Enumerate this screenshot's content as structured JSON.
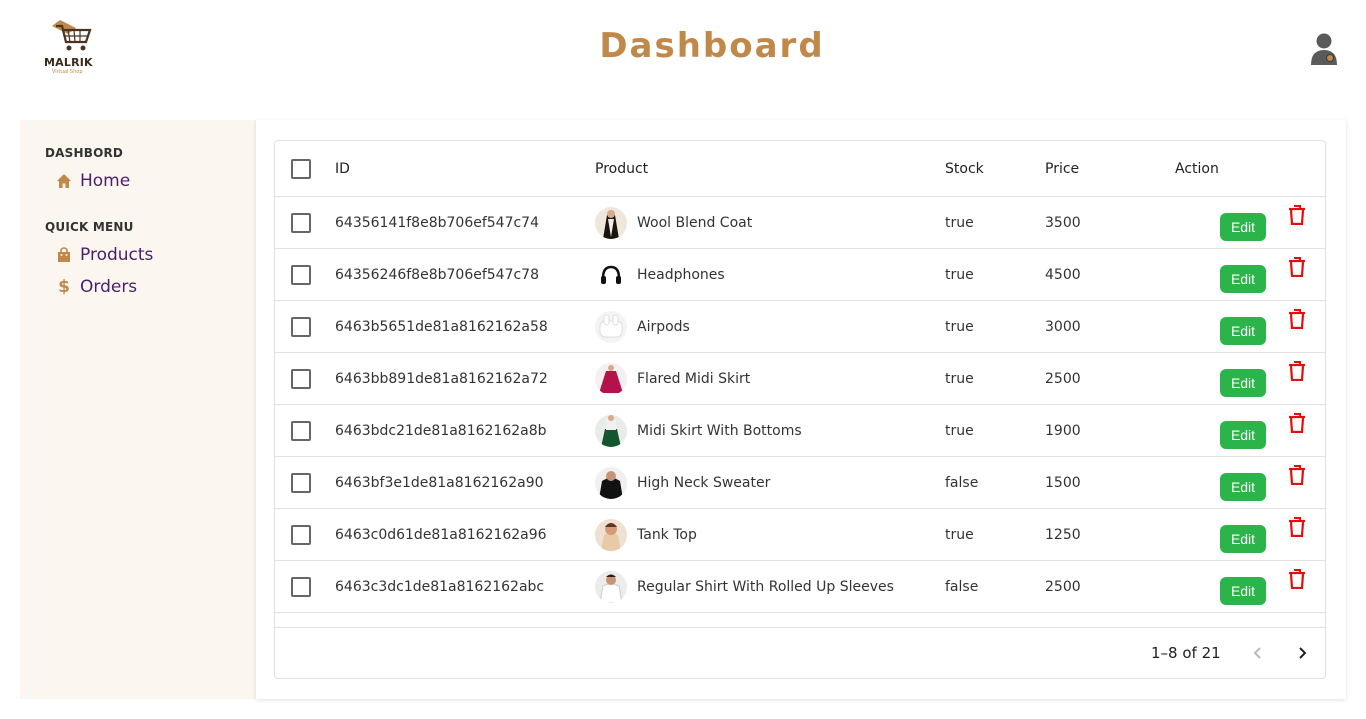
{
  "brand": {
    "name": "MALRIK",
    "tagline": "Virtual Shop"
  },
  "header": {
    "title": "Dashboard"
  },
  "sidebar": {
    "sections": [
      {
        "title": "DASHBORD",
        "items": [
          {
            "label": "Home",
            "icon": "home-icon"
          }
        ]
      },
      {
        "title": "QUICK MENU",
        "items": [
          {
            "label": "Products",
            "icon": "shopping-bag-icon"
          },
          {
            "label": "Orders",
            "icon": "dollar-icon"
          }
        ]
      }
    ]
  },
  "table": {
    "columns": {
      "id": "ID",
      "product": "Product",
      "stock": "Stock",
      "price": "Price",
      "action": "Action"
    },
    "edit_label": "Edit",
    "rows": [
      {
        "id": "64356141f8e8b706ef547c74",
        "product": "Wool Blend Coat",
        "stock": "true",
        "price": "3500"
      },
      {
        "id": "64356246f8e8b706ef547c78",
        "product": "Headphones",
        "stock": "true",
        "price": "4500"
      },
      {
        "id": "6463b5651de81a8162162a58",
        "product": "Airpods",
        "stock": "true",
        "price": "3000"
      },
      {
        "id": "6463bb891de81a8162162a72",
        "product": "Flared Midi Skirt",
        "stock": "true",
        "price": "2500"
      },
      {
        "id": "6463bdc21de81a8162162a8b",
        "product": "Midi Skirt With Bottoms",
        "stock": "true",
        "price": "1900"
      },
      {
        "id": "6463bf3e1de81a8162162a90",
        "product": "High Neck Sweater",
        "stock": "false",
        "price": "1500"
      },
      {
        "id": "6463c0d61de81a8162162a96",
        "product": "Tank Top",
        "stock": "true",
        "price": "1250"
      },
      {
        "id": "6463c3dc1de81a8162162abc",
        "product": "Regular Shirt With Rolled Up Sleeves",
        "stock": "false",
        "price": "2500"
      }
    ],
    "pagination": {
      "text": "1–8 of 21"
    }
  },
  "colors": {
    "accent": "#c0894a",
    "nav_text": "#4b1c6b",
    "edit": "#2bb44a",
    "delete": "#e01010",
    "sidebar_bg": "#fbf7f0"
  }
}
